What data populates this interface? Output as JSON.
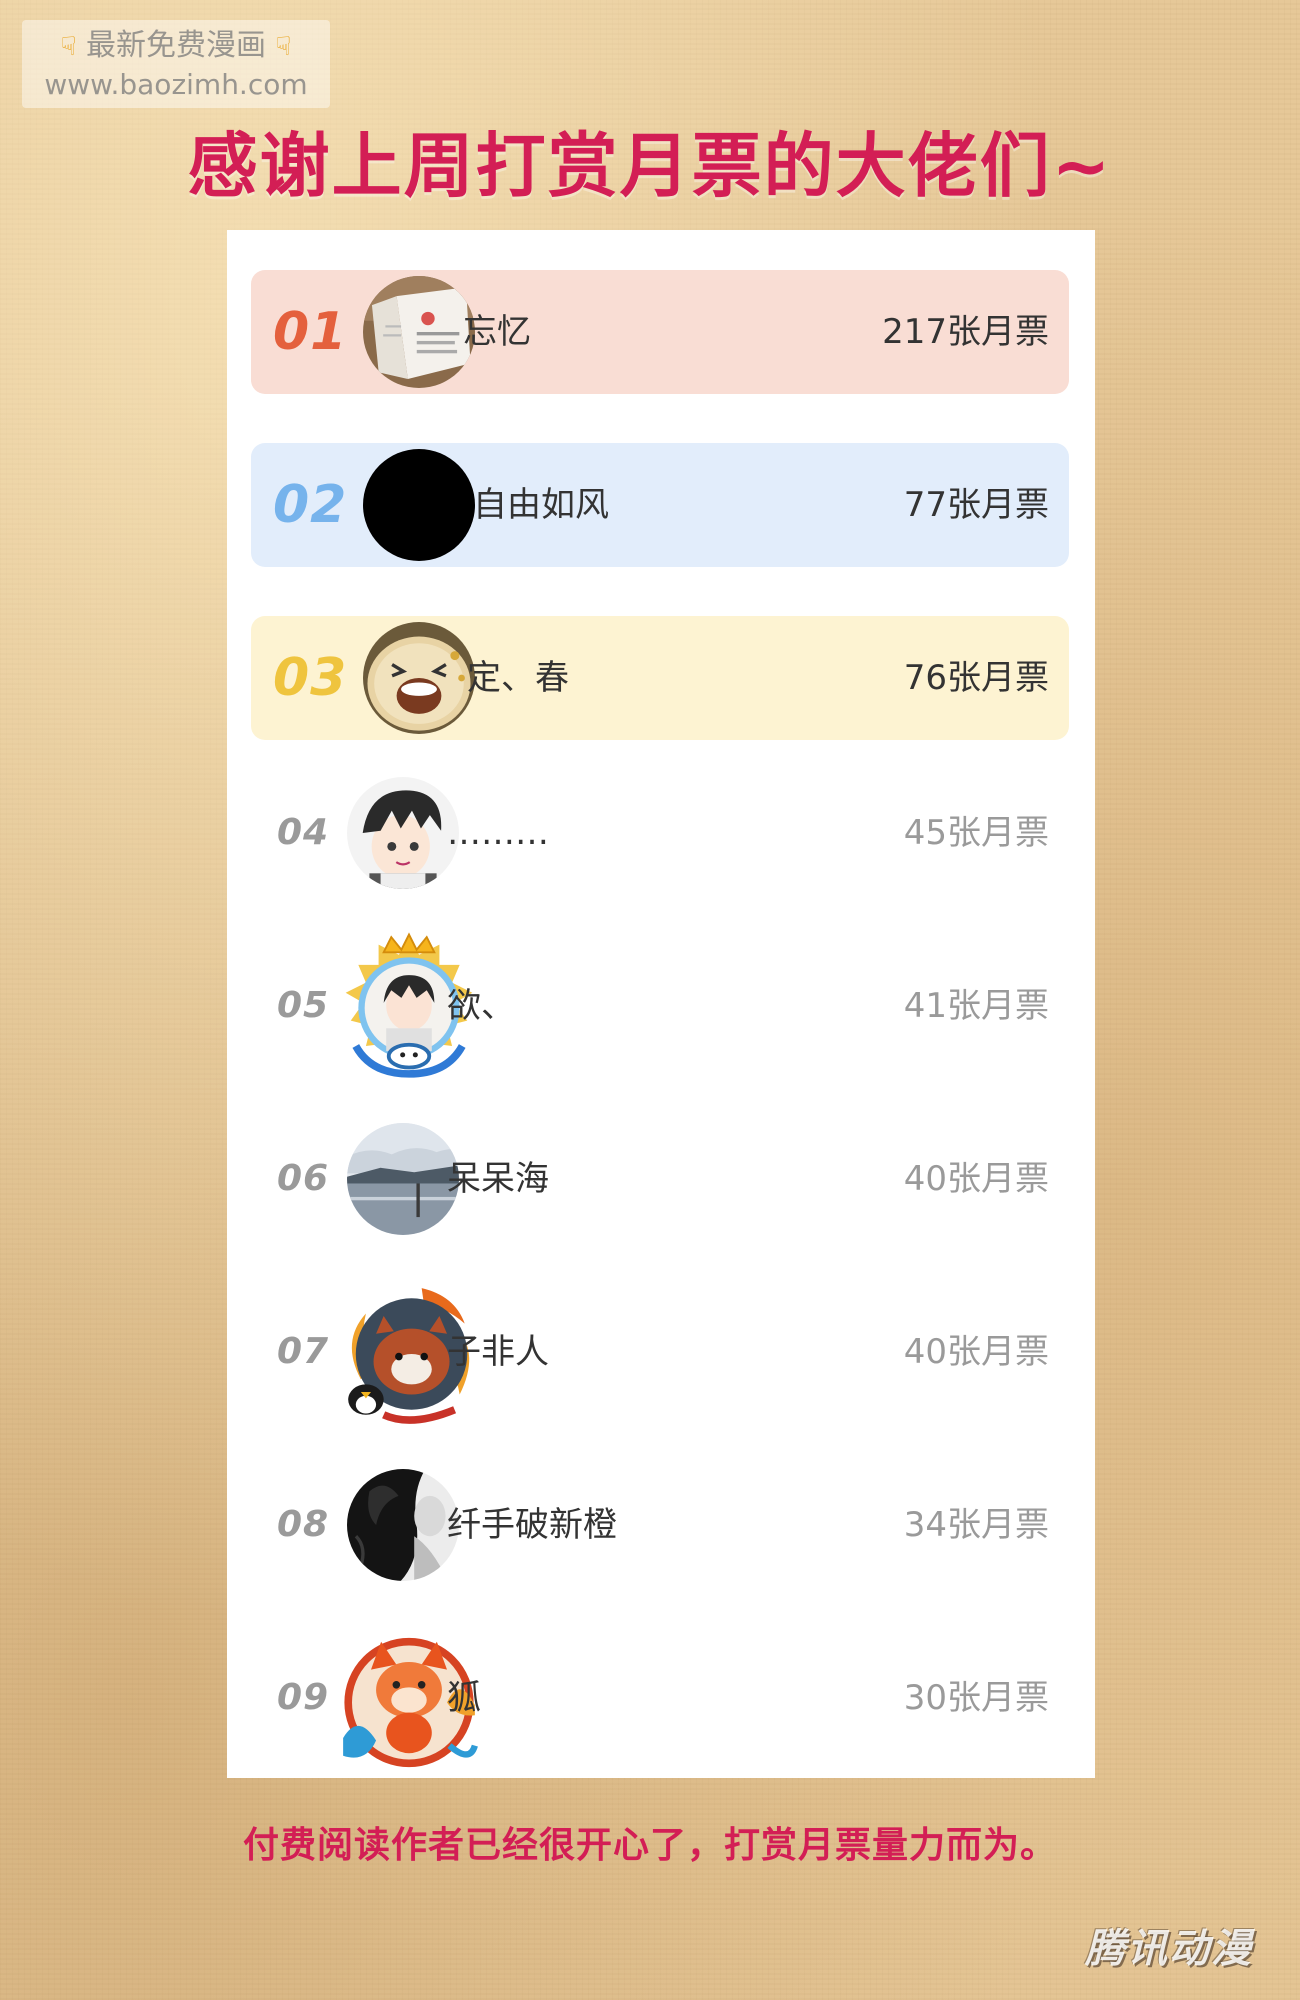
{
  "watermark": {
    "line1": "最新免费漫画",
    "line2": "www.baozimh.com",
    "icon": "pointing-down-hand-icon"
  },
  "title": "感谢上周打赏月票的大佬们~",
  "colors": {
    "title": "#d31e55",
    "rank1": "#e4603d",
    "rank2": "#76b3ec",
    "rank3": "#efc43e",
    "muted": "#9a9a9a",
    "row1_bg": "#f9ddd4",
    "row2_bg": "#e2edfb",
    "row3_bg": "#fdf3d2"
  },
  "ranking": [
    {
      "rank": "01",
      "name": "忘忆",
      "votes": "217张月票",
      "avatar": "book-photo-avatar"
    },
    {
      "rank": "02",
      "name": "自由如风",
      "votes": "77张月票",
      "avatar": "black-circle-avatar"
    },
    {
      "rank": "03",
      "name": "定、春",
      "votes": "76张月票",
      "avatar": "laughing-bun-avatar"
    },
    {
      "rank": "04",
      "name": "………",
      "votes": "45张月票",
      "avatar": "anime-boy-avatar"
    },
    {
      "rank": "05",
      "name": "欲、",
      "votes": "41张月票",
      "avatar": "crown-frame-avatar"
    },
    {
      "rank": "06",
      "name": "呆呆海",
      "votes": "40张月票",
      "avatar": "lake-landscape-avatar"
    },
    {
      "rank": "07",
      "name": "子非人",
      "votes": "40张月票",
      "avatar": "red-panda-avatar"
    },
    {
      "rank": "08",
      "name": "纤手破新橙",
      "votes": "34张月票",
      "avatar": "black-hair-portrait-avatar"
    },
    {
      "rank": "09",
      "name": "狐",
      "votes": "30张月票",
      "avatar": "cartoon-fox-avatar"
    }
  ],
  "footer": "付费阅读作者已经很开心了，打赏月票量力而为。",
  "logo": "腾讯动漫"
}
